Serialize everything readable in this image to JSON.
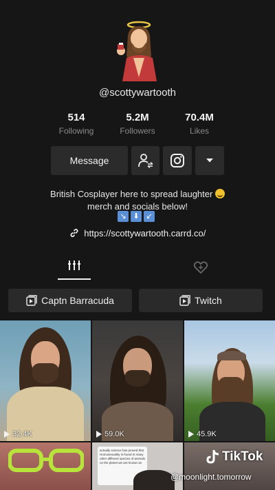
{
  "profile": {
    "username": "@scottywartooth",
    "stats": [
      {
        "value": "514",
        "label": "Following"
      },
      {
        "value": "5.2M",
        "label": "Followers"
      },
      {
        "value": "70.4M",
        "label": "Likes"
      }
    ],
    "bio_line1": "British Cosplayer here to spread laughter",
    "bio_line2": "merch and socials below!",
    "bio_arrows": [
      "↘",
      "⬇",
      "↙"
    ],
    "link": "https://scottywartooth.carrd.co/"
  },
  "actions": {
    "message_label": "Message"
  },
  "playlists": [
    {
      "label": "Captn Barracuda"
    },
    {
      "label": "Twitch"
    }
  ],
  "videos": [
    {
      "views": "32.4K"
    },
    {
      "views": "59.0K"
    },
    {
      "views": "45.9K"
    }
  ],
  "video5_note": "actually science has proved that Homosexuality is found in many other different species of animals on the planet we are known as",
  "watermark": {
    "brand": "TikTok",
    "handle": "@moonlight.tomorrow"
  },
  "colors": {
    "background": "#161616",
    "button": "#2b2b2b",
    "secondary_text": "#8a8a8a"
  },
  "icons": [
    "add-friend-icon",
    "instagram-icon",
    "dropdown-arrow-icon",
    "link-icon",
    "videos-grid-icon",
    "liked-heart-icon",
    "playlist-icon",
    "play-icon"
  ]
}
